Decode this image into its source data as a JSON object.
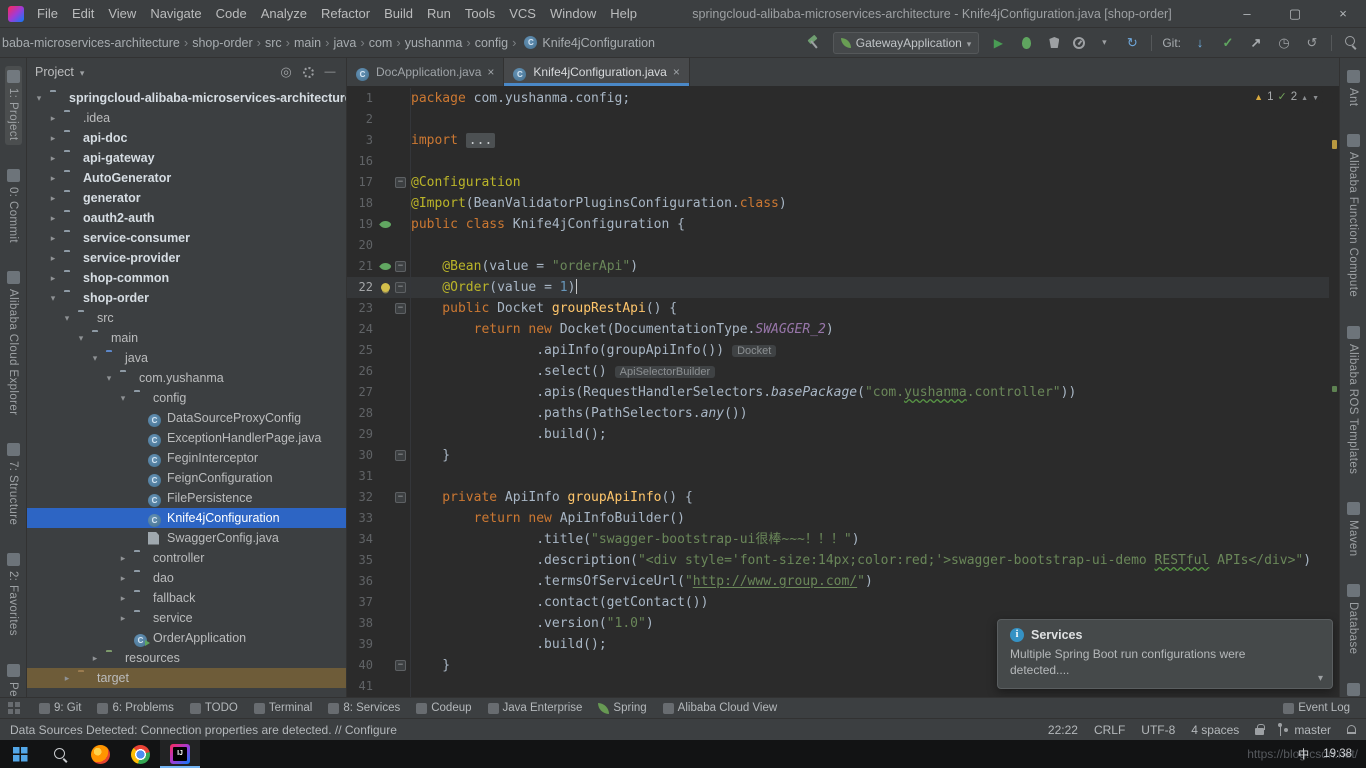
{
  "titlebar": {
    "menus": [
      "File",
      "Edit",
      "View",
      "Navigate",
      "Code",
      "Analyze",
      "Refactor",
      "Build",
      "Run",
      "Tools",
      "VCS",
      "Window",
      "Help"
    ],
    "title": "springcloud-alibaba-microservices-architecture - Knife4jConfiguration.java [shop-order]"
  },
  "toolbar": {
    "breadcrumbs": [
      "baba-microservices-architecture",
      "shop-order",
      "src",
      "main",
      "java",
      "com",
      "yushanma",
      "config",
      "Knife4jConfiguration"
    ],
    "run_config": "GatewayApplication",
    "git_label": "Git:"
  },
  "left_stripe": [
    {
      "label": "1: Project",
      "active": true
    },
    {
      "label": "0: Commit"
    },
    {
      "label": "Alibaba Cloud Explorer"
    },
    {
      "label": "7: Structure"
    },
    {
      "label": "2: Favorites"
    },
    {
      "label": "Persistence"
    }
  ],
  "right_stripe": [
    {
      "label": "Ant"
    },
    {
      "label": "Alibaba Function Compute"
    },
    {
      "label": "Alibaba ROS Templates"
    },
    {
      "label": "Maven"
    },
    {
      "label": "Database"
    },
    {
      "label": "Bean"
    }
  ],
  "project_panel": {
    "header": "Project",
    "tree": [
      {
        "label": "springcloud-alibaba-microservices-architecture",
        "depth": 0,
        "icon": "folder",
        "arrow": "exp",
        "bold": true
      },
      {
        "label": ".idea",
        "depth": 1,
        "icon": "folder",
        "arrow": "col"
      },
      {
        "label": "api-doc",
        "depth": 1,
        "icon": "module",
        "arrow": "col",
        "bold": true
      },
      {
        "label": "api-gateway",
        "depth": 1,
        "icon": "module",
        "arrow": "col",
        "bold": true
      },
      {
        "label": "AutoGenerator",
        "depth": 1,
        "icon": "module",
        "arrow": "col",
        "bold": true
      },
      {
        "label": "generator",
        "depth": 1,
        "icon": "module",
        "arrow": "col",
        "bold": true
      },
      {
        "label": "oauth2-auth",
        "depth": 1,
        "icon": "module",
        "arrow": "col",
        "bold": true
      },
      {
        "label": "service-consumer",
        "depth": 1,
        "icon": "module",
        "arrow": "col",
        "bold": true
      },
      {
        "label": "service-provider",
        "depth": 1,
        "icon": "module",
        "arrow": "col",
        "bold": true
      },
      {
        "label": "shop-common",
        "depth": 1,
        "icon": "module",
        "arrow": "col",
        "bold": true
      },
      {
        "label": "shop-order",
        "depth": 1,
        "icon": "module",
        "arrow": "exp",
        "bold": true
      },
      {
        "label": "src",
        "depth": 2,
        "icon": "folder",
        "arrow": "exp"
      },
      {
        "label": "main",
        "depth": 3,
        "icon": "folder",
        "arrow": "exp"
      },
      {
        "label": "java",
        "depth": 4,
        "icon": "folder-src",
        "arrow": "exp"
      },
      {
        "label": "com.yushanma",
        "depth": 5,
        "icon": "package",
        "arrow": "exp"
      },
      {
        "label": "config",
        "depth": 6,
        "icon": "package",
        "arrow": "exp"
      },
      {
        "label": "DataSourceProxyConfig",
        "depth": 7,
        "icon": "class"
      },
      {
        "label": "ExceptionHandlerPage.java",
        "depth": 7,
        "icon": "class"
      },
      {
        "label": "FeginInterceptor",
        "depth": 7,
        "icon": "class"
      },
      {
        "label": "FeignConfiguration",
        "depth": 7,
        "icon": "class"
      },
      {
        "label": "FilePersistence",
        "depth": 7,
        "icon": "class"
      },
      {
        "label": "Knife4jConfiguration",
        "depth": 7,
        "icon": "class",
        "selected": true
      },
      {
        "label": "SwaggerConfig.java",
        "depth": 7,
        "icon": "file"
      },
      {
        "label": "controller",
        "depth": 6,
        "icon": "package",
        "arrow": "col"
      },
      {
        "label": "dao",
        "depth": 6,
        "icon": "package",
        "arrow": "col"
      },
      {
        "label": "fallback",
        "depth": 6,
        "icon": "package",
        "arrow": "col"
      },
      {
        "label": "service",
        "depth": 6,
        "icon": "package",
        "arrow": "col"
      },
      {
        "label": "OrderApplication",
        "depth": 6,
        "icon": "class-run"
      },
      {
        "label": "resources",
        "depth": 4,
        "icon": "folder-res",
        "arrow": "col"
      },
      {
        "label": "target",
        "depth": 2,
        "icon": "folder-excl",
        "arrow": "col",
        "tint": true
      }
    ]
  },
  "editor": {
    "tabs": [
      {
        "label": "DocApplication.java",
        "active": false
      },
      {
        "label": "Knife4jConfiguration.java",
        "active": true
      }
    ],
    "inspections": {
      "warnings": "1",
      "typos": "2"
    },
    "lines": [
      {
        "n": "1",
        "segs": [
          [
            "package ",
            "kw"
          ],
          [
            "com.yushanma.config;",
            "pln"
          ]
        ]
      },
      {
        "n": "2",
        "segs": []
      },
      {
        "n": "3",
        "segs": [
          [
            "import ",
            "kw"
          ],
          [
            "...",
            "fold"
          ]
        ]
      },
      {
        "n": "16",
        "segs": []
      },
      {
        "n": "17",
        "fold": true,
        "segs": [
          [
            "@Configuration",
            "ann"
          ]
        ]
      },
      {
        "n": "18",
        "segs": [
          [
            "@Import",
            "ann"
          ],
          [
            "(BeanValidatorPluginsConfiguration.",
            "pln"
          ],
          [
            "class",
            "kw"
          ],
          [
            ")",
            "pln"
          ]
        ]
      },
      {
        "n": "19",
        "icon": "bean",
        "segs": [
          [
            "public class ",
            "kw"
          ],
          [
            "Knife4jConfiguration {",
            "pln"
          ]
        ]
      },
      {
        "n": "20",
        "segs": []
      },
      {
        "n": "21",
        "icon": "bean",
        "fold": true,
        "segs": [
          [
            "    @Bean",
            "ann"
          ],
          [
            "(value = ",
            "pln"
          ],
          [
            "\"orderApi\"",
            "str"
          ],
          [
            ")",
            "pln"
          ]
        ]
      },
      {
        "n": "22",
        "current": true,
        "caret": true,
        "icon": "bulb",
        "fold": true,
        "segs": [
          [
            "    @Order",
            "ann"
          ],
          [
            "(value = ",
            "pln"
          ],
          [
            "1",
            "num"
          ],
          [
            ")",
            "pln"
          ]
        ]
      },
      {
        "n": "23",
        "fold": true,
        "segs": [
          [
            "    public ",
            "kw"
          ],
          [
            "Docket ",
            "pln"
          ],
          [
            "groupRestApi",
            "mth"
          ],
          [
            "() {",
            "pln"
          ]
        ]
      },
      {
        "n": "24",
        "segs": [
          [
            "        return new ",
            "kw"
          ],
          [
            "Docket(DocumentationType.",
            "pln"
          ],
          [
            "SWAGGER_2",
            "cst"
          ],
          [
            ")",
            "pln"
          ]
        ]
      },
      {
        "n": "25",
        "segs": [
          [
            "                .apiInfo(groupApiInfo())",
            "pln"
          ],
          [
            "Docket",
            "inlay"
          ]
        ]
      },
      {
        "n": "26",
        "segs": [
          [
            "                .select()",
            "pln"
          ],
          [
            "ApiSelectorBuilder",
            "inlay"
          ]
        ]
      },
      {
        "n": "27",
        "segs": [
          [
            "                .apis(RequestHandlerSelectors.",
            "pln"
          ],
          [
            "basePackage",
            "stm"
          ],
          [
            "(",
            "pln"
          ],
          [
            "\"com.",
            "str"
          ],
          [
            "yushanma",
            "strT"
          ],
          [
            ".controller\"",
            "str"
          ],
          [
            "))",
            "pln"
          ]
        ]
      },
      {
        "n": "28",
        "segs": [
          [
            "                .paths(PathSelectors.",
            "pln"
          ],
          [
            "any",
            "stm"
          ],
          [
            "())",
            "pln"
          ]
        ]
      },
      {
        "n": "29",
        "segs": [
          [
            "                .build();",
            "pln"
          ]
        ]
      },
      {
        "n": "30",
        "fold": true,
        "segs": [
          [
            "    }",
            "pln"
          ]
        ]
      },
      {
        "n": "31",
        "segs": []
      },
      {
        "n": "32",
        "fold": true,
        "segs": [
          [
            "    private ",
            "kw"
          ],
          [
            "ApiInfo ",
            "pln"
          ],
          [
            "groupApiInfo",
            "mth"
          ],
          [
            "() {",
            "pln"
          ]
        ]
      },
      {
        "n": "33",
        "segs": [
          [
            "        return new ",
            "kw"
          ],
          [
            "ApiInfoBuilder()",
            "pln"
          ]
        ]
      },
      {
        "n": "34",
        "segs": [
          [
            "                .title(",
            "pln"
          ],
          [
            "\"swagger-bootstrap-ui很棒~~~！！！\"",
            "str"
          ],
          [
            ")",
            "pln"
          ]
        ]
      },
      {
        "n": "35",
        "segs": [
          [
            "                .description(",
            "pln"
          ],
          [
            "\"<div style='font-size:14px;color:red;'>swagger-bootstrap-ui-demo ",
            "str"
          ],
          [
            "RESTful",
            "strT"
          ],
          [
            " APIs</div>\"",
            "str"
          ],
          [
            ")",
            "pln"
          ]
        ]
      },
      {
        "n": "36",
        "segs": [
          [
            "                .termsOfServiceUrl(",
            "pln"
          ],
          [
            "\"",
            "str"
          ],
          [
            "http://www.group.com/",
            "lnk"
          ],
          [
            "\"",
            "str"
          ],
          [
            ")",
            "pln"
          ]
        ]
      },
      {
        "n": "37",
        "segs": [
          [
            "                .contact(getContact())",
            "pln"
          ]
        ]
      },
      {
        "n": "38",
        "segs": [
          [
            "                .version(",
            "pln"
          ],
          [
            "\"1.0\"",
            "str"
          ],
          [
            ")",
            "pln"
          ]
        ]
      },
      {
        "n": "39",
        "segs": [
          [
            "                .build();",
            "pln"
          ]
        ]
      },
      {
        "n": "40",
        "fold": true,
        "segs": [
          [
            "    }",
            "pln"
          ]
        ]
      },
      {
        "n": "41",
        "segs": []
      }
    ]
  },
  "notification": {
    "title": "Services",
    "body": "Multiple Spring Boot run configurations were detected...."
  },
  "bottom_bar": {
    "left": [
      {
        "label": "9: Git",
        "icon": "git-icon"
      },
      {
        "label": "6: Problems",
        "icon": "problems-icon"
      },
      {
        "label": "TODO",
        "icon": "todo-icon"
      },
      {
        "label": "Terminal",
        "icon": "terminal-icon"
      },
      {
        "label": "8: Services",
        "icon": "services-icon"
      },
      {
        "label": "Codeup",
        "icon": "codeup-icon"
      },
      {
        "label": "Java Enterprise",
        "icon": "java-enterprise-icon"
      },
      {
        "label": "Spring",
        "icon": "spring-icon"
      },
      {
        "label": "Alibaba Cloud View",
        "icon": "alibaba-cloud-icon"
      }
    ],
    "right": [
      {
        "label": "Event Log",
        "icon": "event-log-icon"
      }
    ]
  },
  "status_bar": {
    "message_prefix": "Data Sources Detected: Connection properties are detected. // ",
    "message_link": "Configure",
    "caret": "22:22",
    "line_sep": "CRLF",
    "encoding": "UTF-8",
    "indent": "4 spaces",
    "branch": "master"
  },
  "taskbar": {
    "ime": "中",
    "time": "19:38",
    "watermark": "https://blog.csdn.net/"
  }
}
